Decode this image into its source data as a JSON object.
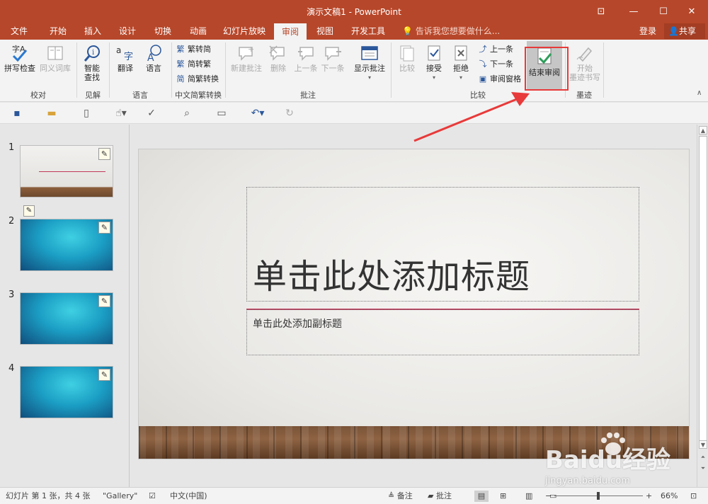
{
  "window": {
    "title": "演示文稿1 - PowerPoint",
    "buttons": {
      "restore_ribbon": "⊡",
      "minimize": "—",
      "maximize": "☐",
      "close": "✕"
    }
  },
  "tabs": [
    {
      "label": "文件"
    },
    {
      "label": "开始"
    },
    {
      "label": "插入"
    },
    {
      "label": "设计"
    },
    {
      "label": "切换"
    },
    {
      "label": "动画"
    },
    {
      "label": "幻灯片放映"
    },
    {
      "label": "审阅",
      "active": true
    },
    {
      "label": "视图"
    },
    {
      "label": "开发工具"
    }
  ],
  "tell_me": "告诉我您想要做什么...",
  "sign_in": "登录",
  "share": "共享",
  "ribbon": {
    "proofing": {
      "spell": "拼写检查",
      "thesaurus": "同义词库",
      "label": "校对"
    },
    "insights": {
      "smart_lookup_l1": "智能",
      "smart_lookup_l2": "查找",
      "label": "见解"
    },
    "language": {
      "translate": "翻译",
      "language": "语言",
      "label": "语言"
    },
    "chinese": {
      "to_simplified": "繁转简",
      "to_traditional": "简转繁",
      "convert": "简繁转换",
      "label": "中文简繁转换"
    },
    "comments": {
      "new": "新建批注",
      "delete": "删除",
      "previous": "上一条",
      "next": "下一条",
      "show": "显示批注",
      "label": "批注"
    },
    "compare": {
      "compare": "比较",
      "accept": "接受",
      "reject": "拒绝",
      "prev": "上一条",
      "next": "下一条",
      "pane": "审阅窗格",
      "end": "结束审阅",
      "label": "比较"
    },
    "ink": {
      "start_l1": "开始",
      "start_l2": "墨迹书写",
      "label": "墨迹"
    }
  },
  "slides": [
    {
      "number": "1"
    },
    {
      "number": "2"
    },
    {
      "number": "3"
    },
    {
      "number": "4"
    }
  ],
  "slide": {
    "title_placeholder": "单击此处添加标题",
    "subtitle_placeholder": "单击此处添加副标题"
  },
  "status": {
    "slide_info": "幻灯片 第 1 张，共 4 张",
    "theme": "\"Gallery\"",
    "language": "中文(中国)",
    "notes": "备注",
    "comments": "批注",
    "zoom": "66%"
  },
  "watermark": {
    "brand": "Baidu经验",
    "url": "jingyan.baidu.com"
  },
  "colors": {
    "accent": "#b7472a",
    "highlight_box": "#e83a3a"
  }
}
